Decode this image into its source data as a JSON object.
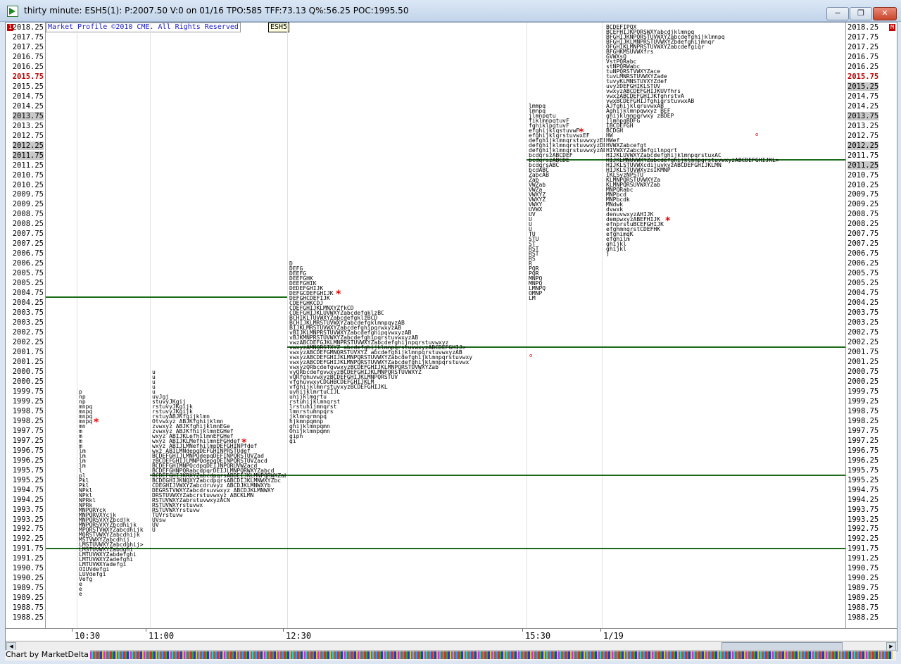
{
  "window": {
    "title": "thirty minute: ESH5(1): P:2007.50 V:0 on 01/16 TPO:585 TFF:73.13 Q%:56.25 POC:1995.50",
    "minimize": "−",
    "restore": "❐",
    "close": "✕"
  },
  "chart": {
    "caption": "Market Profile ©2010 CME. All Rights Reserved",
    "symbol": "ESH5",
    "corner_left": "1",
    "corner_right": "M",
    "price_ticks": [
      "2018.25",
      "2017.75",
      "2017.25",
      "2016.75",
      "2016.25",
      "2015.75",
      "2015.25",
      "2014.75",
      "2014.25",
      "2013.75",
      "2013.25",
      "2012.75",
      "2012.25",
      "2011.75",
      "2011.25",
      "2010.75",
      "2010.25",
      "2009.75",
      "2009.25",
      "2008.75",
      "2008.25",
      "2007.75",
      "2007.25",
      "2006.75",
      "2006.25",
      "2005.75",
      "2005.25",
      "2004.75",
      "2004.25",
      "2003.75",
      "2003.25",
      "2002.75",
      "2002.25",
      "2001.75",
      "2001.25",
      "2000.75",
      "2000.25",
      "1999.75",
      "1999.25",
      "1998.75",
      "1998.25",
      "1997.75",
      "1997.25",
      "1996.75",
      "1996.25",
      "1995.75",
      "1995.25",
      "1994.75",
      "1994.25",
      "1993.75",
      "1993.25",
      "1992.75",
      "1992.25",
      "1991.75",
      "1991.25",
      "1990.75",
      "1990.25",
      "1989.75",
      "1989.25",
      "1988.75",
      "1988.25"
    ],
    "current_price_label": "2015.75",
    "time_labels": [
      "10:30",
      "11:00",
      "12:30",
      "15:30",
      "1/19"
    ],
    "profiles": [
      {
        "name": "10:30",
        "rows": [
          "p",
          "np",
          "np",
          "mnpq",
          "mnpq",
          "mnpq",
          "mnpq",
          "mn",
          "m",
          "m",
          "m",
          "m",
          "lm",
          "lm",
          "lm",
          "lm",
          "l",
          "pl",
          "Pkl",
          "Pkl",
          "NPkl",
          "NPkl",
          "NPRkl",
          "NPRk",
          "MNPQRYck",
          "MNPQRVXYcjk",
          "MNPQRSVXYZbcdjk",
          "MNPQRSVXYZbcdhijk",
          "MPQRSTVWXYZabcdhijk",
          "MQRSTVWXYZabcdhijk",
          "MSTVWXYZabcdhij",
          "LMSTUVWXYZabcdghij>",
          "LMSTUVWXYZabdghi",
          "LMTUVWXYZabdefghi",
          "LMTUVWXYZadefghi",
          "LMTUVWXYadefgi",
          "OIUVdefgi",
          "LUVdefgi",
          "Vefg",
          "e",
          "e",
          "e"
        ]
      },
      {
        "name": "11:00",
        "rows": [
          "u",
          "u",
          "u",
          "u",
          "u",
          "uvJgj",
          "stuvyJKgij",
          "rstuvyJKgijk",
          "rstuvyJKgijk",
          "rstuyABJKfgijklmn",
          "Otvwxyz ABJKfghijklmn",
          "zvwxyz ABJKfghijklmnEGe",
          "zvwxyz ABJKfhijklmnEGHef",
          "wxyz ABIJKLefhilmnEFGHef",
          "wxyz ABIJKLMefhilmnEFGHdef",
          "wxyz ABIJLMNefhilmpDEFGHINPfdef",
          "wxz ABILMNdepqDEFGHINPRSTUdef",
          "BCDEFGHIJLMNPQdepqDEFINPQRSTUVZad",
          "zBCDEFGHIJLMNPQdepqDEINPQRSTUVZacd",
          "BCDEFGHIMNPQcdpqDEIJNPQRUVWZacd",
          "BCDEFGHNPQRabcdpqrDEIJLMNPQRWXYZabcd",
          "BCDEFGHIJKRXYZabcdpqrsABDEIJKLMNPQRWXZabcd>",
          "BCDEGHIJKNQXYZabcdpqrsABCDIJKLMNWXYZbc",
          "CDEGHIJVWXYZabcdruvyz ABCDJKLMNWXYb",
          "DEGRSTVWXYZabcdrsuvwxyz ABCDJKLMNWXY",
          "DRSTUVWXYZabcrstuvwxyz ABCKLMN",
          "RSTUVWXYZabrstuvwxyzACN",
          "RSTUVWXYrstuvwx",
          "RSTUVWXYrstuvw",
          "TUVrstuvw",
          "UVsw",
          "UV",
          "U"
        ]
      },
      {
        "name": "12:30",
        "rows": [
          "D",
          "DEFG",
          "DEEFG",
          "DEEFGHK",
          "DEEFGHIK",
          "DEDEFGHIJK",
          "DEFGCDEFGHIJK",
          "DEFGHCDEFIJK",
          "CDEFGHKCDJ",
          "CDEFGHIJKLMNXYZfkCD",
          "CDEFGHIJKLUVWXYZabcdefgklzBC",
          "BCHIKLTUVWXYZabcdefgklzBCD",
          "BCHIJKLMRSTUVWXYZabcdefgklmnpqyzAB",
          "BIJKLMRSTUVWXYZabcdefghipqrwxyzAB",
          "vBIJKLMNPRSTUVWXYZabcdefghipqvwxyzAB",
          "vBJKMNPRSTUVWXYZabcdefghipqrstuvwxyzAB",
          "vwzABCDEFGJKLMNPRSTUVWXYZabcdefghijnpqrstuvwxyz",
          "vwxyzAMNQRSTXYZ abcdefghijklmnpqrstuvwxyzABCDEFGHIJ>",
          "vwxyzABCDEFGMNQRSTUVXYZ abcdefghijklmnpqrstuvwxyzAB",
          "vwxyzABCDEFGHIJKLMNPQRSTUVWXYZabcdefghijklmnpqrstuvwxy",
          "vwxyzABCDEFGHIJKLMNPQRSTUVWXYZabcdefghijklmnpqrstuvwx",
          "vwxyzQRbcdefgvwxyzBCDEFGHIJKLMNPQRSTUVWXYZab",
          "vyQRbcdefgvwxyzBCDEFGHIJKLMNPQRSTUVWXYZ",
          "vQRfghuvwxyzBCDEFGHIJKLMNPQRSTUV",
          "vfghuvwxyCDGHBCDEFGHIJKLM",
          "vfghijklmnrstuvxyzBCDEFGHIJKL",
          "uvhijklmrtuCIJL",
          "uhijklmqrtu",
          "rstuhijklmnqrst",
          "lrstuhijmnqrst",
          "lmnrstumnpqrs",
          "jklmnqrmnpq",
          "hjkmnpqmnp",
          "ghijklmnpqmn",
          "Ohijklmnpqmn",
          "gipn",
          "gi"
        ]
      },
      {
        "name": "15:30",
        "rows": [
          "lmmpq",
          "lmnpq",
          "jlmnpqtu",
          "fiklmnpqtuvF",
          "fghiklpqtuvF",
          "efghijklqstuvwF",
          "efghijklqrstuvwxEF",
          "defghijklmnqrstuvwxyzEF",
          "defghijklmnqrstuvwxyzDEF",
          "defghijklmnqrstuvwxyzABCDEF>",
          "bcdqrszABCDEF",
          "bcdqrszABCDE",
          "bcdqrsABC",
          "bcdABC",
          "ZabcAB",
          "Zab",
          "VWZab",
          "VWZa",
          "VWXYZ",
          "VWXYZ",
          "VWXY",
          "UVWX",
          "UV",
          "U",
          "U",
          "U",
          "TU",
          "STU",
          "ST",
          "RST",
          "RST",
          "RS",
          "R",
          "PQR",
          "PQR",
          "MNPQ",
          "MNPQ",
          "LMNPQ",
          "OMNP",
          "LM"
        ]
      },
      {
        "name": "1/19",
        "rows": [
          "BCDEFIPQX",
          "BCEFHIJKPQRSWXYabcdjklmnpq",
          "BFGHIJKNPQRSTUVWXYZabcdefghijklmnpq",
          "BFGHIJKLMNPRSTUVWXYZbdefghijmnqr",
          "OFGHIKLMNPRSTUVWXYZabcdefgiqr",
          "BFGHKMSUVWXfrs",
          "GVWXsQ",
          "VstPQRabc",
          "stNPQRWabc",
          "tuNPQRSTVWXYZace",
          "tuvLMNRSTUVWXYZade",
          "tuvyKLMNSTUVXYZdef",
          "uvyzDEFGHIKLSTUV",
          "vwxyzABCDEFGHIJKUVfhrs",
          "vwxzABCDEFGHIJKfghrstvA",
          "vwxBCDEFGHIJfghiqrstuvwxAB",
          "AJfghijklqruvwxAB",
          "Aghijklmnpqwxyz BEF",
          "ghijklmnpqrwxy zBDEP",
          "jlmnpqBDFG",
          "IBCDEFGH",
          "BCDGH",
          "HW",
          "HWef",
          "HVWXZabcefgt",
          "HIVWXYZabcdefgilnpqrt",
          "HIJKLUVWXYZabcdefghijklmnpqrstuxAC",
          "HIJKLMNUVWXYZabcdefghijklmnpqrstuvwxyzABCDEFGHIJKL>",
          "HIJKLSTUVWXcdijuvkyzABCDEFGHIJKLMN",
          "HIJKLSTUVWXyzsIKMNP",
          "IKLSyzNPSTU",
          "KLMNPQRSTUVWXYZa",
          "KLMNPQRSUVWXYZab",
          "MNPQRabc",
          "MNPbcd",
          "MNPbcdk",
          "MNdwk",
          "dvwxk",
          "denuvwxyzAHIJK",
          "dempwxyzABEFHIJK",
          "efnprstuBCEFGHIJK",
          "efghmnqrstCDEFHK",
          "efghimqK",
          "efghilm",
          "ghijkl",
          "ghijkl",
          "j"
        ]
      }
    ]
  },
  "status": {
    "text": "Chart by MarketDelta"
  }
}
